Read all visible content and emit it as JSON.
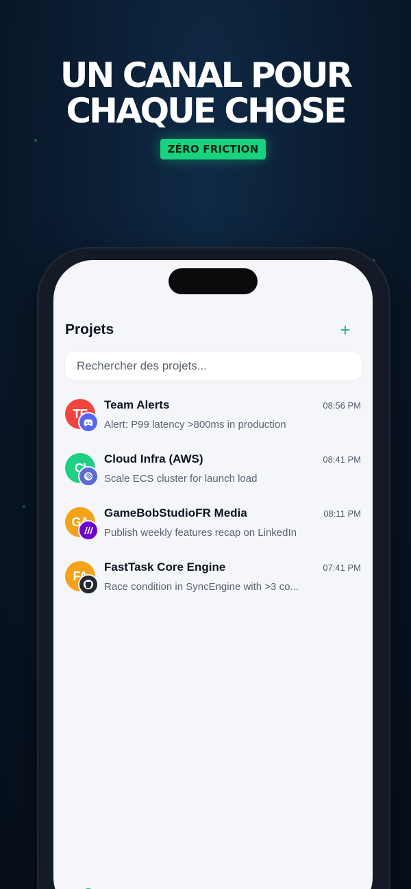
{
  "hero": {
    "headline_line1": "UN CANAL POUR",
    "headline_line2": "CHAQUE CHOSE",
    "badge": "ZÉRO FRICTION"
  },
  "app": {
    "title": "Projets",
    "add_icon": "plus-icon",
    "search_placeholder": "Rechercher des projets...",
    "projects": [
      {
        "initials": "TE",
        "name": "Team Alerts",
        "time": "08:56 PM",
        "message": "Alert: P99 latency >800ms in production",
        "avatar_color": "#f0443e",
        "platform_icon": "discord-icon",
        "platform_color": "#5865f2"
      },
      {
        "initials": "CI",
        "name": "Cloud Infra (AWS)",
        "time": "08:41 PM",
        "message": "Scale ECS cluster for launch load",
        "avatar_color": "#1fcf83",
        "platform_icon": "linear-icon",
        "platform_color": "#5e6ad2"
      },
      {
        "initials": "GA",
        "name": "GameBobStudioFR Media",
        "time": "08:11 PM",
        "message": "Publish weekly features recap on LinkedIn",
        "avatar_color": "#f4a21a",
        "platform_icon": "make-icon",
        "platform_color": "#6d00cc"
      },
      {
        "initials": "FA",
        "name": "FastTask Core Engine",
        "time": "07:41 PM",
        "message": "Race condition in SyncEngine with >3 co...",
        "avatar_color": "#f4a21a",
        "platform_icon": "github-icon",
        "platform_color": "#24292f"
      }
    ],
    "tabs": [
      "home-icon",
      "channels-icon",
      "layers-icon",
      "settings-icon"
    ],
    "accent_color": "#19d27f"
  }
}
